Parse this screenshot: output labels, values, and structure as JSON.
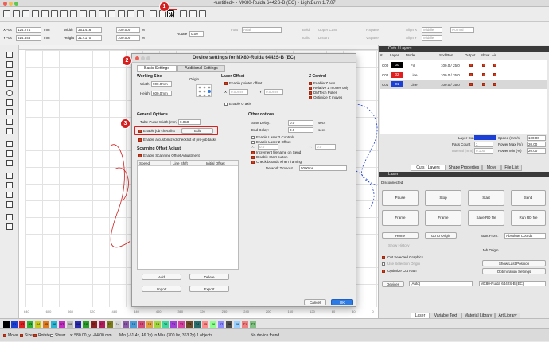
{
  "window": {
    "title": "<untitled> - MX80-Ruida 6442S-B (EC) - LightBurn 1.7.07"
  },
  "toolbar": {
    "icons": [
      "open-icon",
      "save-icon",
      "undo-icon",
      "redo-icon",
      "zoom-in-icon",
      "zoom-out-icon",
      "frame-icon",
      "device-settings-icon",
      "machine-settings-icon"
    ]
  },
  "position": {
    "xpos_label": "XPos",
    "xpos_value": "124.274",
    "ypos_label": "YPos",
    "ypos_value": "314.646",
    "unit": "mm",
    "width_label": "Width",
    "width_value": "351.416",
    "height_label": "Height",
    "height_value": "317.170",
    "pct1": "100.000",
    "pct2": "100.000",
    "pct_unit": "%",
    "rotate_label": "Rotate",
    "rotate_value": "0.00",
    "font_label": "Font",
    "font_value": "Arial",
    "height2_label": "Height",
    "hspace_label": "HSpace",
    "vspace_label": "VSpace",
    "bold_label": "Bold",
    "italic_label": "Italic",
    "upper_case": "Upper Case",
    "distort": "Distort",
    "welded": "Welded",
    "align_x_label": "Align X",
    "align_y_label": "Align Y",
    "align_x_value": "Middle",
    "align_y_value": "Middle",
    "offset_label": "Offset",
    "normal_value": "Normal"
  },
  "rulers": {
    "bottom": [
      "640",
      "600",
      "560",
      "520",
      "480",
      "440",
      "400",
      "360",
      "320",
      "280",
      "240",
      "200",
      "160",
      "120",
      "80",
      "40",
      "0"
    ],
    "top": [
      "640",
      "600",
      "560",
      "520"
    ]
  },
  "dialog": {
    "title": "Device settings for MX80-Ruida 6442S-B (EC)",
    "tabs": [
      "Basic Settings",
      "Additional Settings"
    ],
    "working_size": "Working Size",
    "width_label": "Width",
    "width_value": "900.0mm",
    "height_label": "Height",
    "height_value": "600.0mm",
    "origin_label": "Origin",
    "laser_offset": "Laser Offset",
    "enable_pointer_offset": "Enable pointer offset",
    "x_label": "X",
    "x_value": "0.00mm",
    "y_label": "Y",
    "y_value": "0.00mm",
    "enable_u_axis": "Enable U axis",
    "z_control": "Z Control",
    "z_items": [
      "Enable Z axis",
      "Relative Z moves only",
      "DMTech Poller",
      "Optimize Z moves"
    ],
    "general_options": "General Options",
    "tube_pulse_label": "Tube Pulse Width (mm)",
    "tube_pulse_value": "0.050",
    "enable_job_checklist": "Enable job checklist",
    "edit_label": "Edit",
    "custom_checklist": "Enable a customized checklist of pre-job tasks",
    "scanning_offset": "Scanning Offset Adjust",
    "enable_scanning": "Enable Scanning Offset Adjustment",
    "table_headers": [
      "Speed",
      "Line Shift",
      "Initial Offset"
    ],
    "add": "Add",
    "delete": "Delete",
    "import": "Import",
    "export": "Export",
    "other_options": "Other options",
    "start_delay_label": "Start Delay:",
    "start_delay_value": "0.0",
    "secs": "secs",
    "end_delay_label": "End Delay:",
    "end_delay_value": "0.0",
    "other_items": [
      "Enable Laser 2 Controls",
      "Enable Laser 2 Offset",
      "Increment filename on Send",
      "Disable Start button",
      "Check bounds when framing"
    ],
    "x2_label": "X:",
    "x2_value": "0.0",
    "y2_label": "Y:",
    "y2_value": "0.0",
    "network_timeout_label": "Network Timeout",
    "network_timeout_value": "5000ms",
    "cancel": "Cancel",
    "ok": "OK"
  },
  "cuts": {
    "panel_title": "Cuts / Layers",
    "headers": [
      "#",
      "Layer",
      "Mode",
      "Spd/Pwr",
      "Output",
      "Show",
      "Air"
    ],
    "rows": [
      {
        "num": "C00",
        "layer": "00",
        "mode": "Fill",
        "spdpwr": "100.0 / 25.0",
        "color": "#000000"
      },
      {
        "num": "C02",
        "layer": "02",
        "mode": "Line",
        "spdpwr": "100.0 / 35.0",
        "color": "#e02020"
      },
      {
        "num": "C01",
        "layer": "01",
        "mode": "Line",
        "spdpwr": "100.0 / 35.0",
        "color": "#1c3fd6"
      }
    ],
    "layer_color_label": "Layer Color",
    "speed_label": "Speed (mm/s)",
    "speed_value": "100.00",
    "pass_count_label": "Pass Count",
    "pass_count_value": "1",
    "power_max_label": "Power Max (%)",
    "power_max_value": "20.00",
    "interval_label": "Interval (mm)",
    "interval_value": "0.100",
    "power_min_label": "Power Min (%)",
    "power_min_value": "20.00",
    "tabs": [
      "Cuts / Layers",
      "Shape Properties",
      "Move",
      "File List"
    ]
  },
  "laser": {
    "panel_title": "Laser",
    "status": "Disconnected",
    "pause": "Pause",
    "stop": "Stop",
    "start": "Start",
    "send": "Send",
    "frame1": "Frame",
    "frame2": "Frame",
    "save_rd": "Save RD file",
    "run_rd": "Run RD file",
    "home": "Home",
    "go_origin": "Go to Origin",
    "start_from_label": "Start From:",
    "start_from_value": "Absolute Coords",
    "job_origin": "Job Origin",
    "show_history": "Show History",
    "cut_selected": "Cut Selected Graphics",
    "use_selection_origin": "Use Selection Origin",
    "show_last_position": "Show Last Position",
    "optimize_cut_path": "Optimize Cut Path",
    "optimization_settings": "Optimization Settings",
    "devices_button": "Devices",
    "auto": "(Auto)",
    "device_name": "MX80-Ruida 6442S-B (EC)",
    "bottom_tabs": [
      "Laser",
      "Variable Text",
      "Material Library",
      "Art Library"
    ]
  },
  "palette": [
    {
      "n": "00",
      "c": "#000000"
    },
    {
      "n": "01",
      "c": "#1c3fd6"
    },
    {
      "n": "02",
      "c": "#e02020"
    },
    {
      "n": "03",
      "c": "#2fb02f"
    },
    {
      "n": "04",
      "c": "#c9c918"
    },
    {
      "n": "05",
      "c": "#e07a1a"
    },
    {
      "n": "06",
      "c": "#29b5d6"
    },
    {
      "n": "07",
      "c": "#c42bc4"
    },
    {
      "n": "08",
      "c": "#bdbdbd"
    },
    {
      "n": "09",
      "c": "#2b2bb0"
    },
    {
      "n": "10",
      "c": "#2aa02a"
    },
    {
      "n": "11",
      "c": "#8a2020"
    },
    {
      "n": "12",
      "c": "#b01c5a"
    },
    {
      "n": "13",
      "c": "#7a7a1c"
    },
    {
      "n": "14",
      "c": "#d6d6d6"
    },
    {
      "n": "15",
      "c": "#8a5aa8"
    },
    {
      "n": "16",
      "c": "#4a9ad6"
    },
    {
      "n": "17",
      "c": "#d64a7a"
    },
    {
      "n": "18",
      "c": "#e0a040"
    },
    {
      "n": "19",
      "c": "#a0d640"
    },
    {
      "n": "20",
      "c": "#40d6a0"
    },
    {
      "n": "21",
      "c": "#a040d6"
    },
    {
      "n": "22",
      "c": "#d640a0"
    },
    {
      "n": "23",
      "c": "#6b4a2a"
    },
    {
      "n": "24",
      "c": "#2a6b6b"
    },
    {
      "n": "25",
      "c": "#ff8c8c"
    },
    {
      "n": "26",
      "c": "#8cff8c"
    },
    {
      "n": "27",
      "c": "#8c8cff"
    },
    {
      "n": "28",
      "c": "#4f4f4f"
    },
    {
      "n": "29",
      "c": "#9ad0ff"
    },
    {
      "n": "T1",
      "c": "#f08080"
    },
    {
      "n": "T2",
      "c": "#80c080"
    }
  ],
  "status": {
    "move": "Move",
    "size": "Size",
    "rotate": "Rotate",
    "shear": "Shear",
    "coords": "x: 580.00, y: -84.00 mm",
    "bounds": "Min (-51.4x, 46.1y) to Max (300.0x, 363.2y)  1 objects",
    "device": "No device found"
  },
  "badges": [
    "1",
    "2",
    "3"
  ],
  "colors": {
    "accent": "#d61f1f",
    "focus_blue": "#2f7be5",
    "panel_dark": "#3a3a3a"
  }
}
